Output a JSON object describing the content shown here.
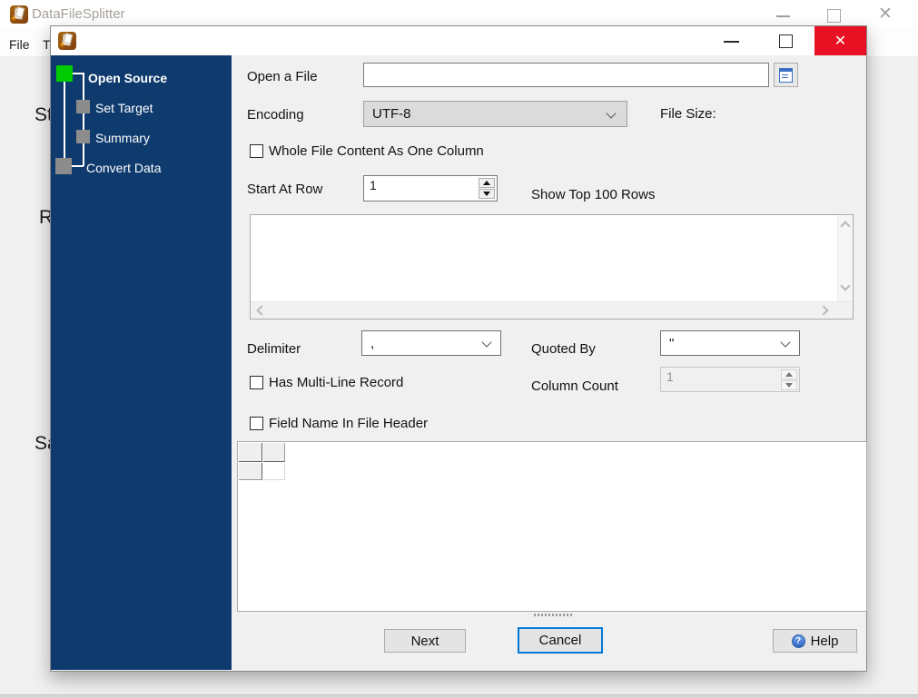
{
  "main_window": {
    "title": "DataFileSplitter",
    "menu_items": [
      {
        "label": "File"
      },
      {
        "label": "T"
      }
    ],
    "background_partial_labels": [
      "St",
      "R",
      "Sa"
    ]
  },
  "dialog": {
    "wizard": {
      "steps": [
        {
          "label": "Open Source",
          "state": "active"
        },
        {
          "label": "Set Target",
          "state": "pending"
        },
        {
          "label": "Summary",
          "state": "pending"
        },
        {
          "label": "Convert Data",
          "state": "pending"
        }
      ]
    },
    "open_file": {
      "label": "Open a File",
      "value": ""
    },
    "encoding": {
      "label": "Encoding",
      "value": "UTF-8"
    },
    "file_size_label": "File Size:",
    "checkbox_whole_file": "Whole File Content As One Column",
    "start_at_row": {
      "label": "Start At Row",
      "value": "1"
    },
    "show_top_label": "Show Top 100 Rows",
    "preview_content": "",
    "delimiter": {
      "label": "Delimiter",
      "value": ","
    },
    "quoted_by": {
      "label": "Quoted By",
      "value": "\""
    },
    "checkbox_multiline": "Has Multi-Line Record",
    "column_count": {
      "label": "Column Count",
      "value": "1",
      "disabled": true
    },
    "checkbox_field_name": "Field Name In File Header",
    "buttons": {
      "next": "Next",
      "cancel": "Cancel",
      "help": "Help"
    },
    "close_glyph": "✕"
  },
  "icons": {
    "app": "documents-plus-icon",
    "browse": "document-icon",
    "help": "question-circle-icon"
  },
  "colors": {
    "sidebar_navy": "#0F3A6E",
    "active_step_green": "#00CB00",
    "pending_step_gray": "#8C8C8C",
    "close_button_red": "#E81123",
    "focus_border_blue": "#0078D7",
    "help_icon_blue": "#3B71C8",
    "window_bg": "#F0F0F0"
  }
}
